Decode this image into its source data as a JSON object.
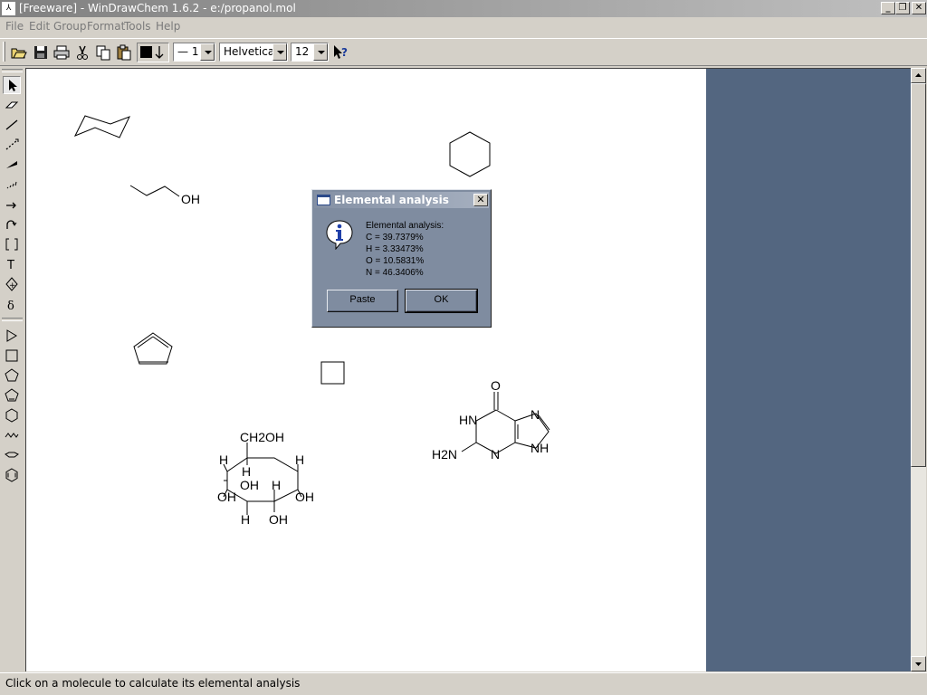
{
  "window": {
    "title": "[Freeware] - WinDrawChem 1.6.2 - e:/propanol.mol",
    "app_icon": "windrawchem-icon",
    "minimize_glyph": "_",
    "restore_glyph": "❐",
    "close_glyph": "✕"
  },
  "menubar": {
    "items": [
      "File",
      "Edit",
      "Group",
      "Format",
      "Tools",
      "Help"
    ]
  },
  "toolbar": {
    "buttons": [
      "open-icon",
      "save-icon",
      "print-icon",
      "cut-icon",
      "copy-icon",
      "paste-icon"
    ],
    "line_style_value": "— 1",
    "font_value": "Helvetica",
    "font_size_value": "12",
    "help_icon": "context-help-icon"
  },
  "toolbox": {
    "tools": [
      "select",
      "erase",
      "single-bond",
      "dashed-bond",
      "wedge-bond",
      "hashed-bond",
      "arrow",
      "curved-arrow",
      "bracket",
      "text",
      "symbol",
      "delta-charge",
      "triangle-ring",
      "square-ring",
      "pentagon-ring",
      "cyclopentadiene-ring",
      "hexagon-ring",
      "chain",
      "chair",
      "hexagon-flat"
    ],
    "active_tool": "select"
  },
  "canvas": {
    "labels": {
      "oh_propanol": "OH",
      "ch2oh": "CH2OH",
      "sugar_h1": "H",
      "sugar_h2": "H",
      "sugar_h3": "H",
      "sugar_oh1": "OH",
      "sugar_h4": "H",
      "sugar_oh2": "OH",
      "sugar_oh3": "OH",
      "sugar_h5": "H",
      "sugar_oh4": "OH",
      "guanine_o": "O",
      "guanine_hn": "HN",
      "guanine_n7": "N",
      "guanine_nh": "NH",
      "guanine_h2n": "H2N",
      "guanine_n3": "N"
    }
  },
  "dialog": {
    "title": "Elemental analysis",
    "icon": "info-icon",
    "lines": [
      "Elemental analysis:",
      "C = 39.7379%",
      "H = 3.33473%",
      "O = 10.5831%",
      "N = 46.3406%"
    ],
    "paste_label": "Paste",
    "ok_label": "OK"
  },
  "statusbar": {
    "text": "Click on a molecule to calculate its elemental analysis"
  },
  "colors": {
    "canvas_background": "#ffffff",
    "workspace": "#536680",
    "dialog_background": "#7f8ca0",
    "chrome": "#d4d0c8"
  }
}
